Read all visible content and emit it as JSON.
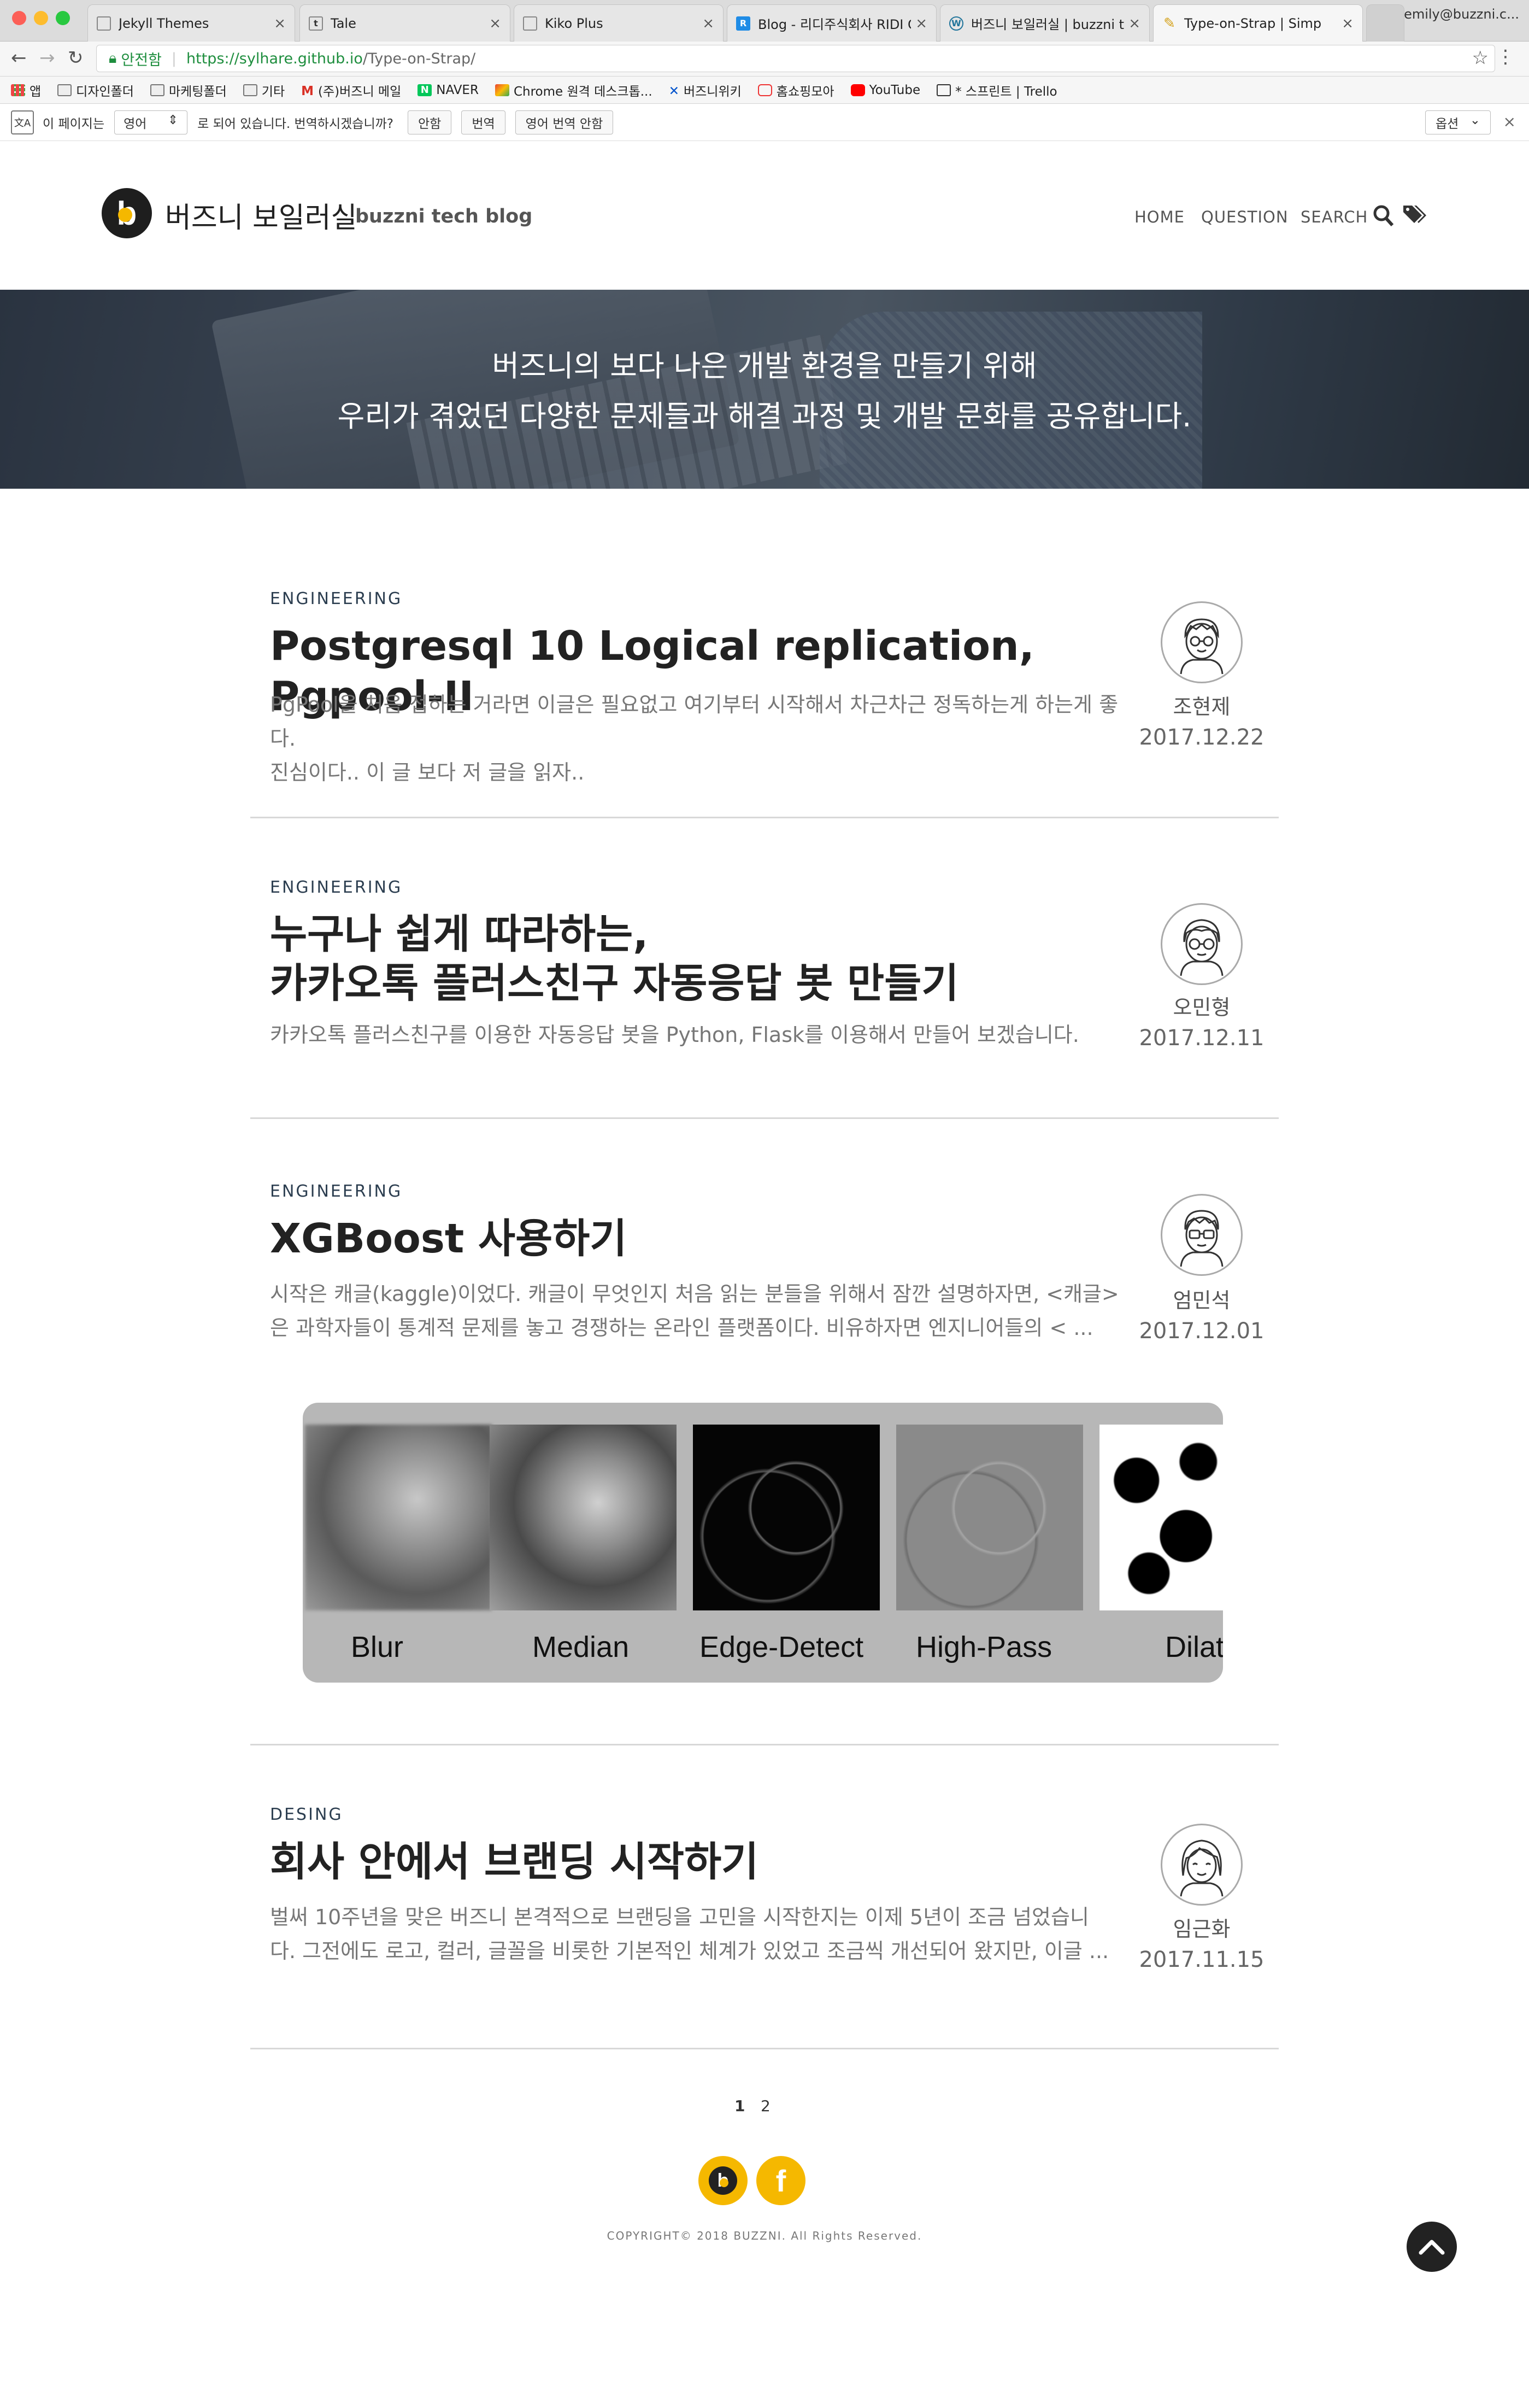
{
  "browser": {
    "tabs": [
      {
        "title": "Jekyll Themes"
      },
      {
        "title": "Tale"
      },
      {
        "title": "Kiko Plus"
      },
      {
        "title": "Blog - 리디주식회사 RIDI Co"
      },
      {
        "title": "버즈니 보일러실 | buzzni te"
      },
      {
        "title": "Type-on-Strap | Simp"
      }
    ],
    "profile": "emily@buzzni.c...",
    "security_label": "안전함",
    "url_host": "https://sylhare.github.io",
    "url_path": "/Type-on-Strap/",
    "bookmarks": [
      "앱",
      "디자인폴더",
      "마케팅폴더",
      "기타",
      "(주)버즈니 메일",
      "NAVER",
      "Chrome 원격 데스크톱...",
      "버즈니위키",
      "홈쇼핑모아",
      "YouTube",
      "* 스프린트 | Trello"
    ],
    "translate_bar": {
      "text_before": "이 페이지는",
      "language": "영어",
      "text_after": "로 되어 있습니다. 번역하시겠습니까?",
      "btn_no": "안함",
      "btn_translate": "번역",
      "btn_never": "영어 번역 안함",
      "options": "옵션"
    }
  },
  "site": {
    "title": "버즈니 보일러실",
    "subtitle": "buzzni tech blog",
    "nav": [
      "HOME",
      "QUESTION",
      "SEARCH"
    ],
    "hero_line1": "버즈니의 보다 나은 개발 환경을 만들기 위해",
    "hero_line2": "우리가 겪었던 다양한 문제들과 해결 과정 및 개발 문화를 공유합니다."
  },
  "posts": [
    {
      "category": "ENGINEERING",
      "title": "Postgresql 10 Logical replication, Pgpool-II",
      "excerpt_1": "PgPool을 처음 접하는 거라면 이글은 필요없고 여기부터 시작해서 차근차근 정독하는게 하는게 좋다.",
      "excerpt_2": "진심이다.. 이 글 보다 저 글을 읽자..",
      "author": "조현제",
      "date": "2017.12.22"
    },
    {
      "category": "ENGINEERING",
      "title_1": "누구나 쉽게 따라하는,",
      "title_2": "카카오톡 플러스친구 자동응답 봇 만들기",
      "excerpt_1": "카카오톡 플러스친구를 이용한 자동응답 봇을 Python, Flask를 이용해서 만들어 보겠습니다.",
      "author": "오민형",
      "date": "2017.12.11"
    },
    {
      "category": "ENGINEERING",
      "title": "XGBoost 사용하기",
      "excerpt_1": "시작은 캐글(kaggle)이었다. 캐글이 무엇인지 처음 읽는 분들을 위해서 잠깐 설명하자면, <캐글>",
      "excerpt_2": "은 과학자들이 통계적 문제를 놓고 경쟁하는 온라인 플랫폼이다. 비유하자면 엔지니어들의 < ...",
      "author": "엄민석",
      "date": "2017.12.01",
      "filters": [
        "Blur",
        "Median",
        "Edge-Detect",
        "High-Pass",
        "Dilat"
      ]
    },
    {
      "category": "DESING",
      "title": "회사 안에서 브랜딩 시작하기",
      "excerpt_1": "벌써 10주년을 맞은 버즈니 본격적으로 브랜딩을 고민을 시작한지는 이제 5년이 조금  넘었습니",
      "excerpt_2": "다. 그전에도 로고, 컬러, 글꼴을 비롯한 기본적인 체계가 있었고 조금씩 개선되어 왔지만, 이글 ...",
      "author": "임근화",
      "date": "2017.11.15"
    }
  ],
  "pagination": {
    "current": "1",
    "next": "2"
  },
  "footer": {
    "copyright": "COPYRIGHT© 2018 BUZZNI. All Rights Reserved."
  },
  "colors": {
    "accent": "#f5b800",
    "dark": "#222222"
  }
}
